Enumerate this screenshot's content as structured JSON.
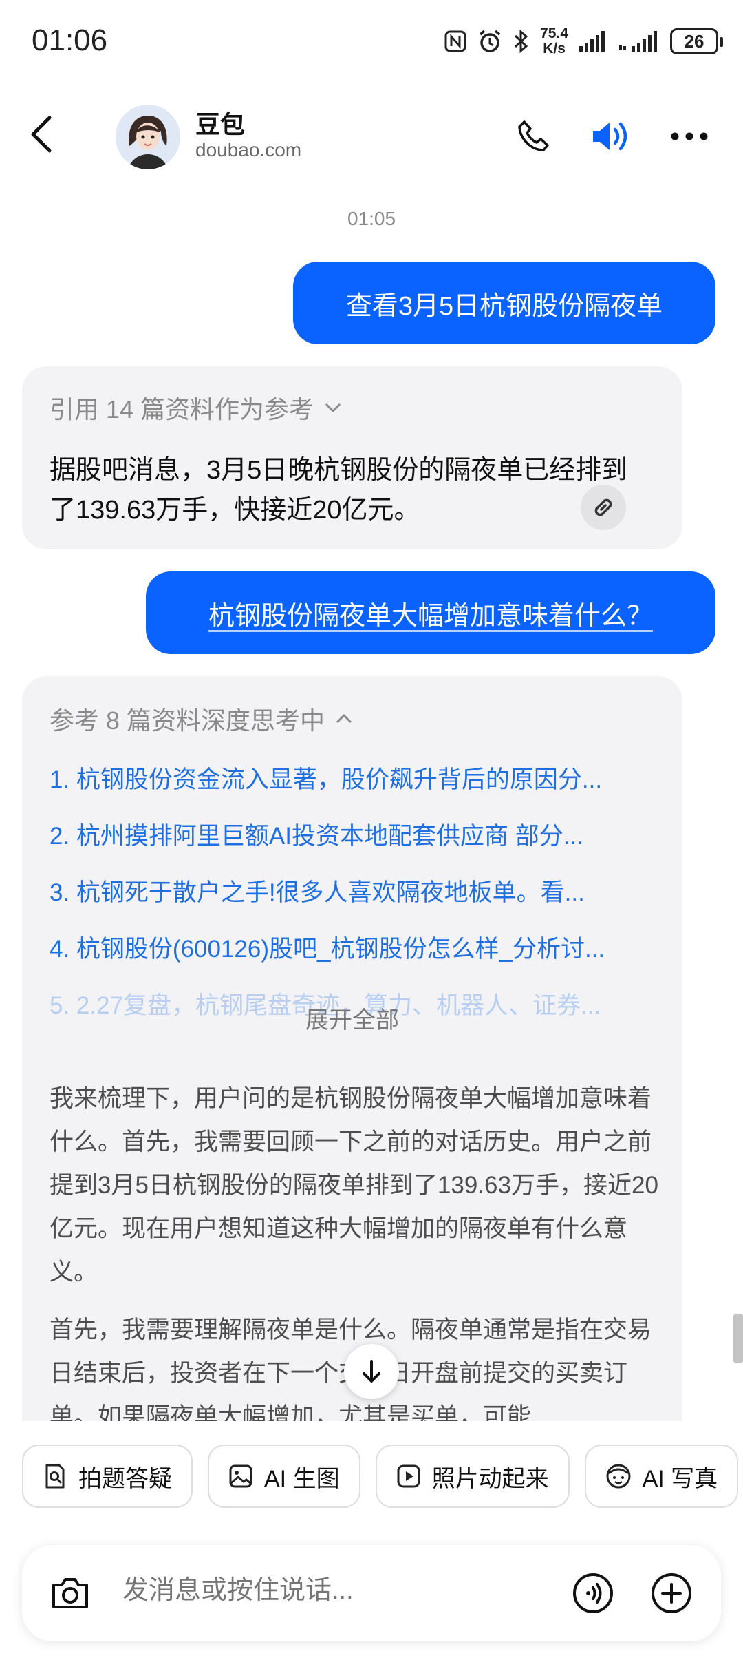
{
  "status_bar": {
    "time": "01:06",
    "net_speed_value": "75.4",
    "net_speed_unit": "K/s",
    "battery": "26"
  },
  "header": {
    "bot_name": "豆包",
    "bot_domain": "doubao.com"
  },
  "timestamp": "01:05",
  "messages": {
    "user1": "查看3月5日杭钢股份隔夜单",
    "bot1_refs": "引用 14 篇资料作为参考",
    "bot1_text": "据股吧消息，3月5日晚杭钢股份的隔夜单已经排到了139.63万手，快接近20亿元。",
    "user2": "杭钢股份隔夜单大幅增加意味着什么？",
    "bot2_refs": "参考 8 篇资料深度思考中",
    "bot2_ref_items": [
      "1. 杭钢股份资金流入显著，股价飙升背后的原因分...",
      "2. 杭州摸排阿里巨额AI投资本地配套供应商 部分...",
      "3. 杭钢死于散户之手!很多人喜欢隔夜地板单。看...",
      "4. 杭钢股份(600126)股吧_杭钢股份怎么样_分析讨...",
      "5. 2.27复盘，杭钢尾盘奇迹，算力、机器人、证券..."
    ],
    "expand_all": "展开全部",
    "bot2_para1": "我来梳理下，用户问的是杭钢股份隔夜单大幅增加意味着什么。首先，我需要回顾一下之前的对话历史。用户之前提到3月5日杭钢股份的隔夜单排到了139.63万手，接近20亿元。现在用户想知道这种大幅增加的隔夜单有什么意义。",
    "bot2_para2": "首先，我需要理解隔夜单是什么。隔夜单通常是指在交易日结束后，投资者在下一个交易日开盘前提交的买卖订单。如果隔夜单大幅增加，尤其是买单，可能"
  },
  "chips": [
    "拍题答疑",
    "AI 生图",
    "照片动起来",
    "AI 写真"
  ],
  "input": {
    "placeholder": "发消息或按住说话..."
  },
  "colors": {
    "accent": "#0a63ff",
    "link": "#1f6fe0",
    "card_bg": "#f3f3f5"
  }
}
